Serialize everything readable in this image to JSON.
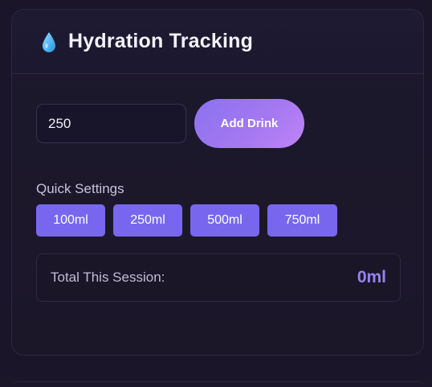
{
  "header": {
    "icon": "water-drop-icon",
    "title": "Hydration Tracking"
  },
  "entry": {
    "amount_value": "250",
    "add_label": "Add Drink"
  },
  "quick_settings": {
    "label": "Quick Settings",
    "options": [
      "100ml",
      "250ml",
      "500ml",
      "750ml"
    ]
  },
  "total": {
    "label": "Total This Session:",
    "value": "0ml"
  },
  "colors": {
    "accent": "#7867ee",
    "accent_gradient_end": "#c084f6",
    "total_value": "#9682f2",
    "background": "#1a1528"
  }
}
